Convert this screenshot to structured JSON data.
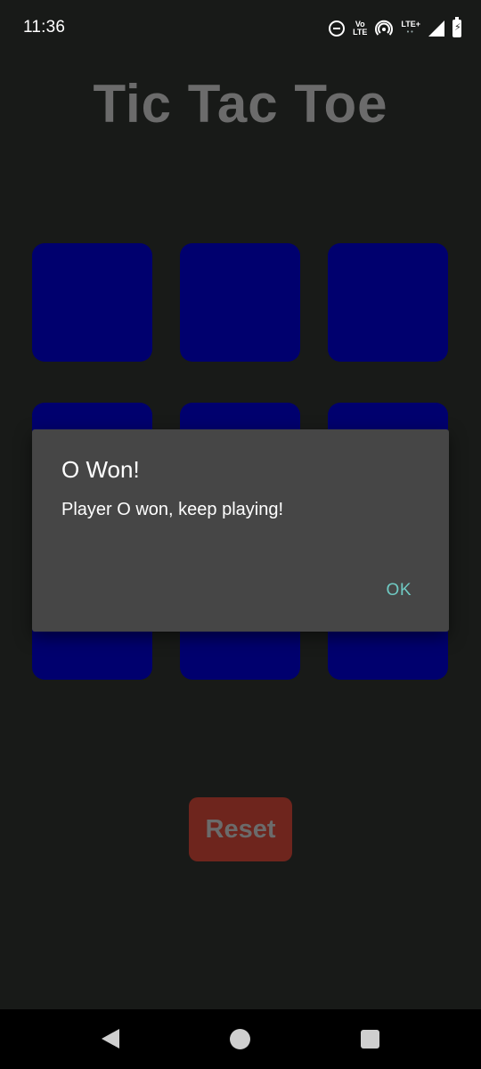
{
  "status_bar": {
    "time": "11:36",
    "icons": [
      "do-not-disturb-icon",
      "volte-icon",
      "hotspot-icon",
      "lte-plus-icon",
      "signal-icon",
      "battery-charging-icon"
    ],
    "volte_top": "Vo",
    "volte_bottom": "LTE",
    "lte_label": "LTE+"
  },
  "app": {
    "title": "Tic Tac Toe",
    "board": {
      "cells": [
        "",
        "",
        "",
        "",
        "",
        "",
        "",
        "",
        ""
      ],
      "cell_color": "#00006e"
    },
    "reset_label": "Reset",
    "reset_color": "#6e251d"
  },
  "dialog": {
    "title": "O Won!",
    "message": "Player O won, keep playing!",
    "ok_label": "OK",
    "accent_color": "#6fc9c2"
  },
  "nav_bar": {
    "icons": [
      "back-icon",
      "home-icon",
      "recents-icon"
    ]
  }
}
